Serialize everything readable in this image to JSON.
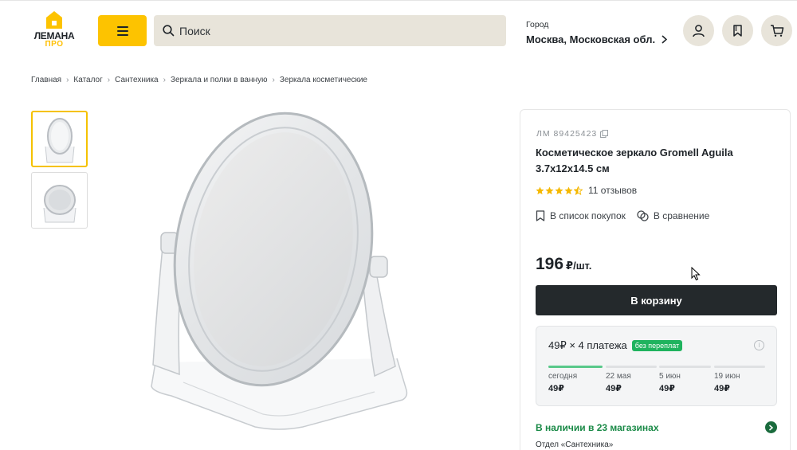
{
  "header": {
    "logo_line1": "ЛЕМАНА",
    "logo_line2": "ПРО",
    "search_placeholder": "Поиск",
    "city_label": "Город",
    "city_value": "Москва, Московская обл.",
    "icons": [
      "menu-icon",
      "search-icon",
      "user-icon",
      "bookmark-icon",
      "cart-icon"
    ]
  },
  "breadcrumbs": [
    "Главная",
    "Каталог",
    "Сантехника",
    "Зеркала и полки в ванную",
    "Зеркала косметические"
  ],
  "product": {
    "sku": "ЛМ 89425423",
    "title": "Косметическое зеркало Gromell Aguila 3.7x12x14.5 см",
    "rating": 4.5,
    "reviews": "11 отзывов",
    "add_to_list": "В список покупок",
    "compare": "В сравнение",
    "price": "196",
    "price_unit": "₽/шт.",
    "cart_button": "В корзину"
  },
  "installments": {
    "headline": "49₽ × 4 платежа",
    "badge": "без переплат",
    "payments": [
      {
        "date": "сегодня",
        "amount": "49₽"
      },
      {
        "date": "22 мая",
        "amount": "49₽"
      },
      {
        "date": "5 июн",
        "amount": "49₽"
      },
      {
        "date": "19 июн",
        "amount": "49₽"
      }
    ]
  },
  "availability": {
    "stock_text": "В наличии в 23 магазинах",
    "department": "Отдел «Сантехника»"
  },
  "colors": {
    "brand_yellow": "#fdc300",
    "dark": "#24292c",
    "green": "#1a8a47",
    "star": "#f5b800"
  }
}
